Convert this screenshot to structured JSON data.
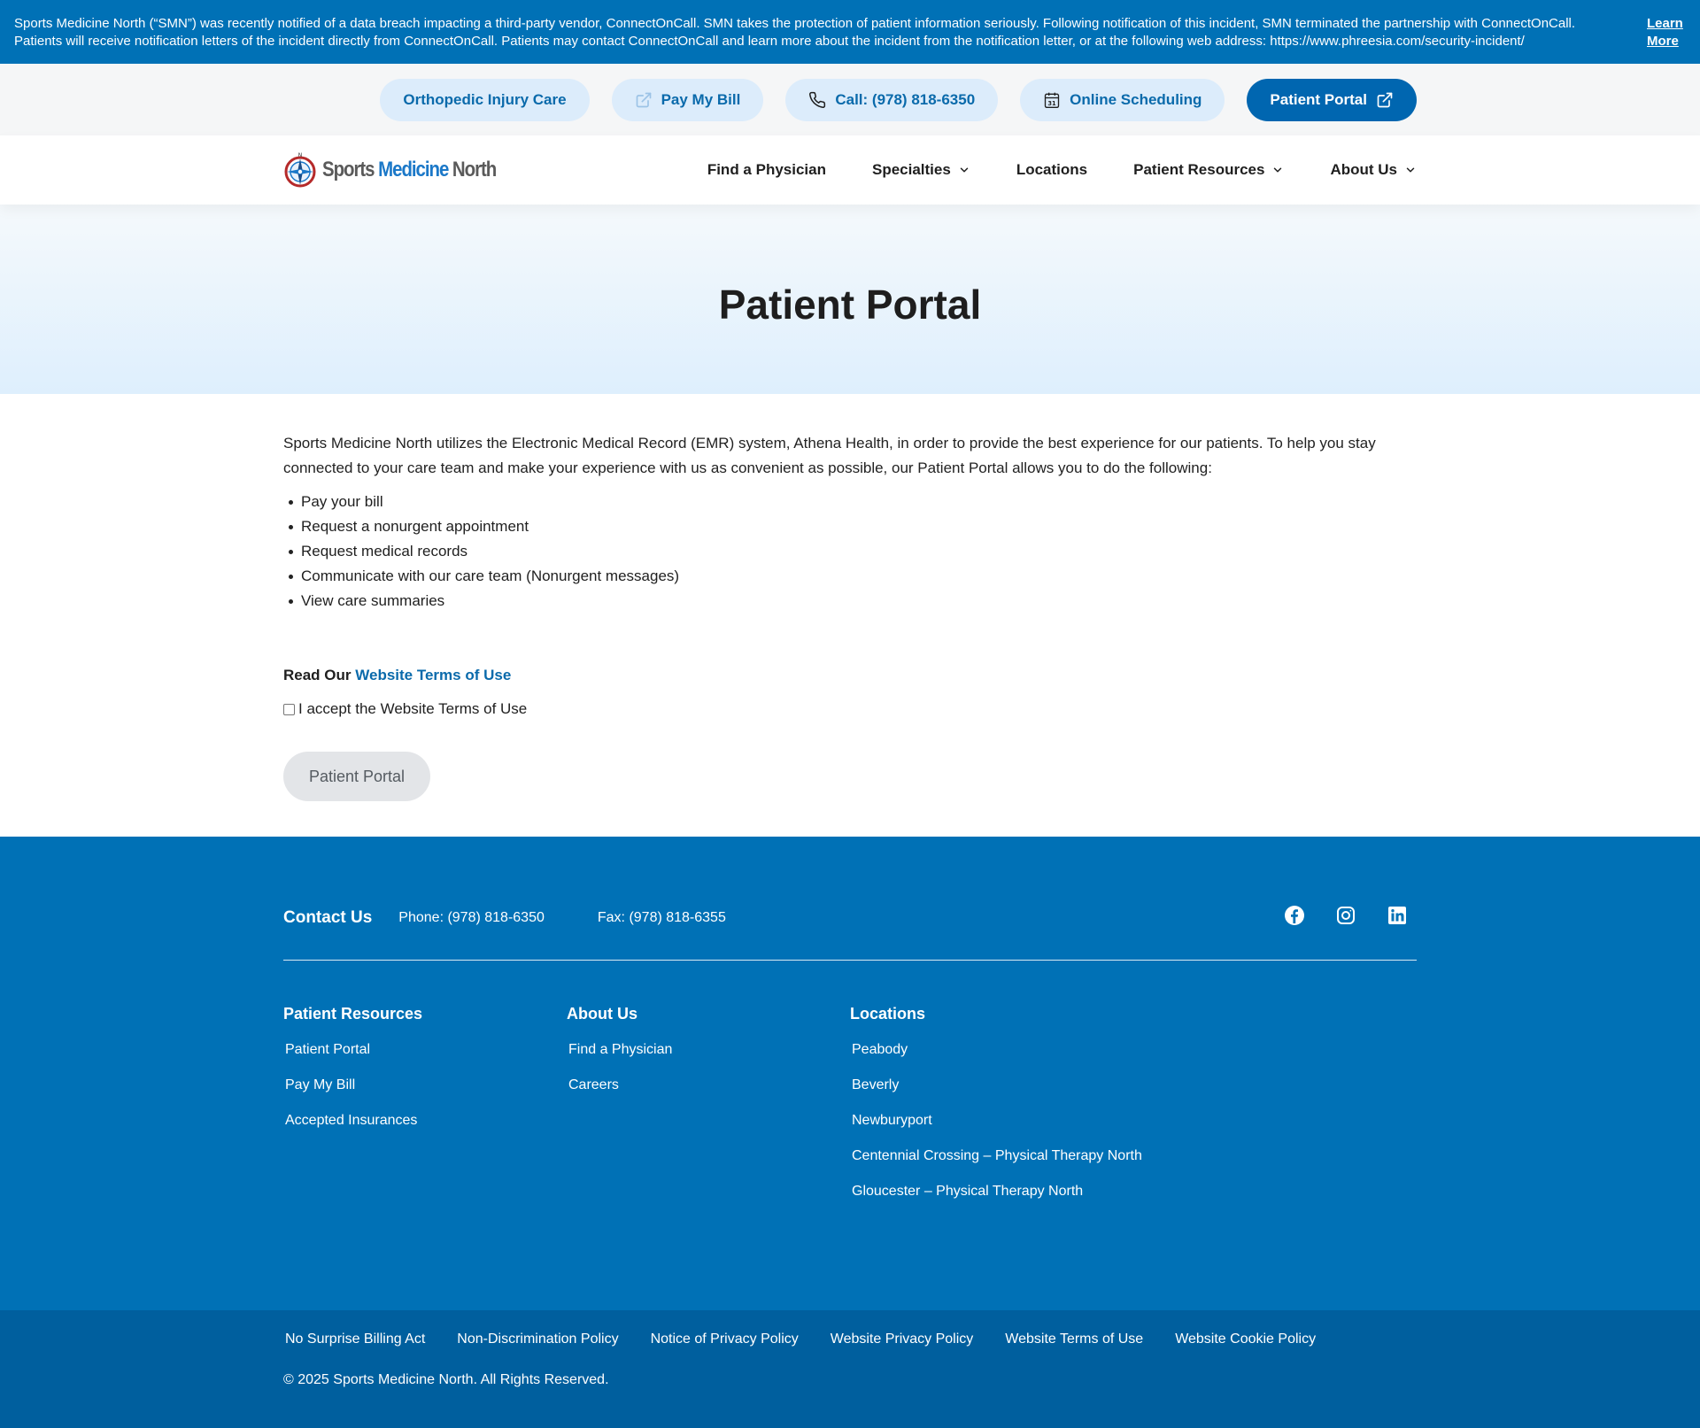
{
  "alert": {
    "text": "Sports Medicine North (“SMN”) was recently notified of a data breach impacting a third-party vendor, ConnectOnCall. SMN takes the protection of patient information seriously. Following notification of this incident, SMN terminated the partnership with ConnectOnCall. Patients will receive notification letters of the incident directly from ConnectOnCall. Patients may contact ConnectOnCall and learn more about the incident from the notification letter, or at the following web address: https://www.phreesia.com/security-incident/",
    "learn_more": "Learn More"
  },
  "utility": {
    "orthopedic": "Orthopedic Injury Care",
    "pay_bill": "Pay My Bill",
    "call": "Call: (978) 818-6350",
    "scheduling": "Online Scheduling",
    "portal": "Patient Portal"
  },
  "header": {
    "logo_part1": "Sports",
    "logo_part2": "Medicine",
    "logo_part3": "North",
    "nav": {
      "find": "Find a Physician",
      "specialties": "Specialties",
      "locations": "Locations",
      "resources": "Patient Resources",
      "about": "About Us"
    }
  },
  "hero": {
    "title": "Patient Portal"
  },
  "content": {
    "intro": "Sports Medicine North utilizes the Electronic Medical Record (EMR) system, Athena Health, in order to provide the best experience for our patients. To help you stay connected to your care team and make your experience with us as convenient as possible, our Patient Portal allows you to do the following:",
    "features": [
      "Pay your bill",
      "Request a nonurgent appointment",
      "Request medical records",
      "Communicate with our care team (Nonurgent messages)",
      "View care summaries"
    ],
    "read_our": "Read Our",
    "terms_link": "Website Terms of Use",
    "accept_label": "I accept the Website Terms of Use",
    "portal_button": "Patient Portal"
  },
  "footer": {
    "contact_title": "Contact Us",
    "phone": "Phone: (978) 818-6350",
    "fax": "Fax: (978) 818-6355",
    "cols": [
      {
        "title": "Patient Resources",
        "links": [
          "Patient Portal",
          "Pay My Bill",
          "Accepted Insurances"
        ]
      },
      {
        "title": "About Us",
        "links": [
          "Find a Physician",
          "Careers"
        ]
      },
      {
        "title": "Locations",
        "links": [
          "Peabody",
          "Beverly",
          "Newburyport",
          "Centennial Crossing – Physical Therapy North",
          "Gloucester – Physical Therapy North"
        ]
      }
    ],
    "policies": [
      "No Surprise Billing Act",
      "Non-Discrimination Policy",
      "Notice of Privacy Policy",
      "Website Privacy Policy",
      "Website Terms of Use",
      "Website Cookie Policy"
    ],
    "copyright": "© 2025 Sports Medicine North. All Rights Reserved."
  },
  "colors": {
    "brand_blue": "#0071b6",
    "dark_blue": "#005f9e",
    "pill_bg": "#dcecfb",
    "link_blue": "#0a6aab"
  },
  "icons": {
    "pay_bill": "external-link-icon",
    "call": "phone-icon",
    "scheduling": "calendar-icon",
    "portal": "external-link-icon",
    "social": [
      "facebook-icon",
      "instagram-icon",
      "linkedin-icon"
    ]
  }
}
